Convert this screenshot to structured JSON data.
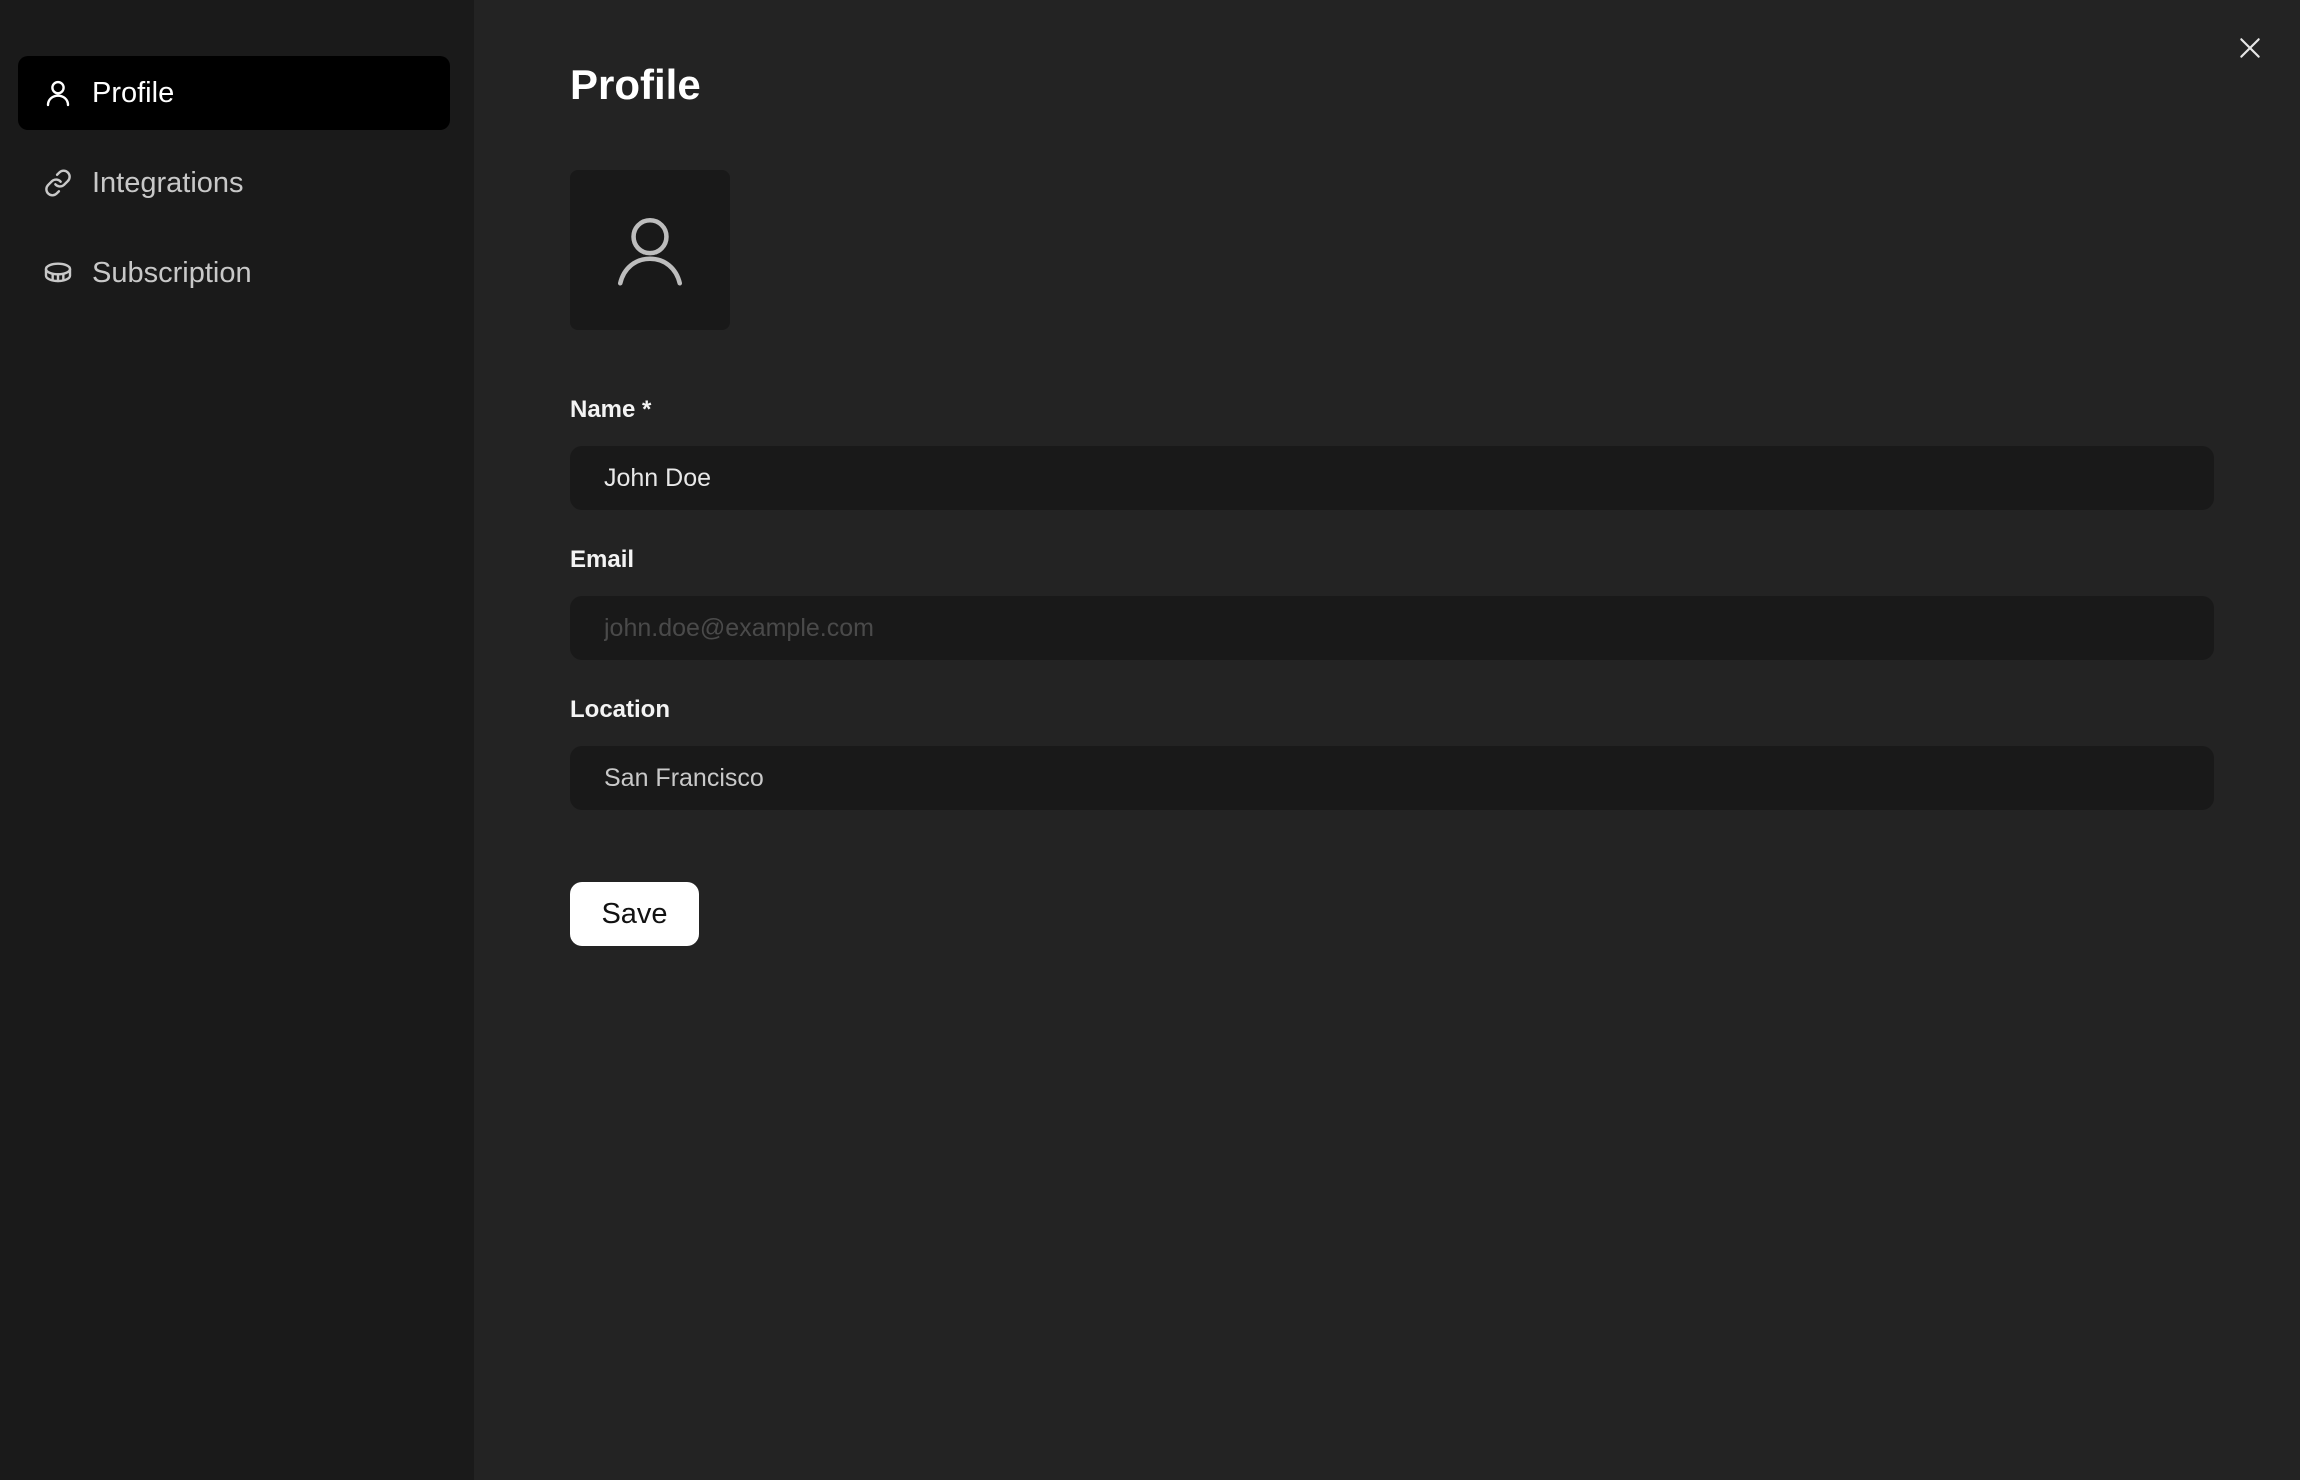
{
  "sidebar": {
    "items": [
      {
        "label": "Profile",
        "icon": "user-icon",
        "active": true
      },
      {
        "label": "Integrations",
        "icon": "link-icon",
        "active": false
      },
      {
        "label": "Subscription",
        "icon": "coin-icon",
        "active": false
      }
    ]
  },
  "main": {
    "title": "Profile",
    "avatar_icon": "user-avatar-icon",
    "close_icon": "close-icon",
    "fields": {
      "name": {
        "label": "Name *",
        "value": "John Doe",
        "placeholder": ""
      },
      "email": {
        "label": "Email",
        "value": "",
        "placeholder": "john.doe@example.com"
      },
      "location": {
        "label": "Location",
        "value": "San Francisco",
        "placeholder": ""
      }
    },
    "save_label": "Save"
  },
  "colors": {
    "background": "#232323",
    "sidebar": "#1a1a1a",
    "active_item": "#000000",
    "input": "#191919",
    "button": "#ffffff"
  }
}
